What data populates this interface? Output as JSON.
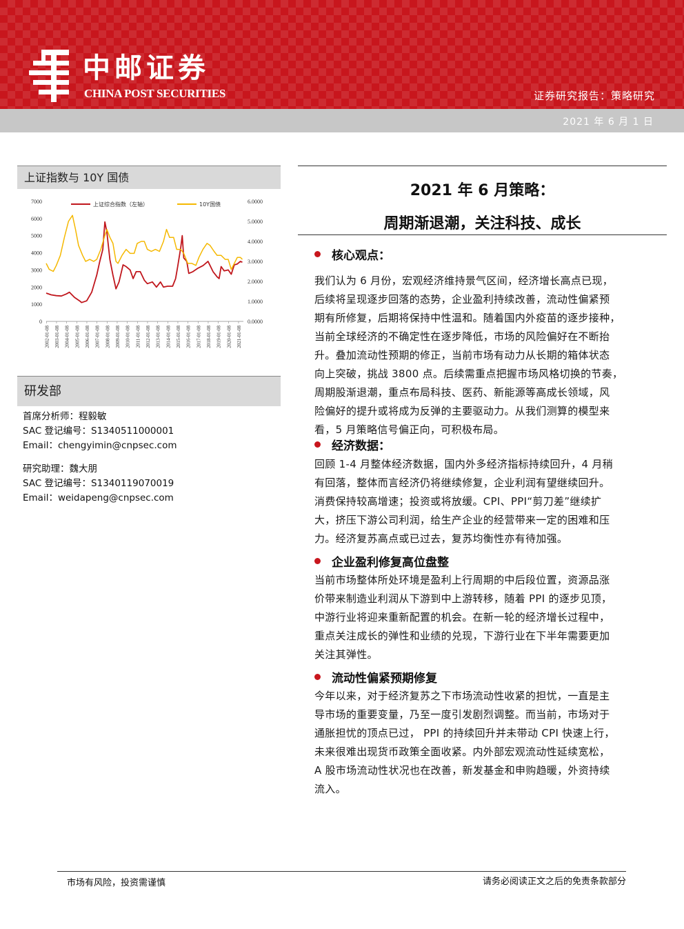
{
  "header": {
    "brand_cn": "中邮证券",
    "brand_en": "CHINA POST SECURITIES",
    "report_type": "证券研究报告：策略研究",
    "date": "2021 年 6 月 1 日",
    "colors": {
      "brand_red": "#c8161d",
      "date_bar": "#c7c7c7"
    }
  },
  "chart_box": {
    "title": "上证指数与 10Y 国债"
  },
  "chart_data": {
    "type": "line",
    "title": "",
    "xlabel": "",
    "ylabel": "",
    "x_ticks": [
      "2002-01-08",
      "2003-01-08",
      "2004-01-08",
      "2005-01-08",
      "2006-01-08",
      "2007-01-08",
      "2008-01-08",
      "2009-01-08",
      "2010-01-08",
      "2011-01-08",
      "2012-01-08",
      "2013-01-08",
      "2014-01-08",
      "2015-01-08",
      "2016-01-08",
      "2017-01-08",
      "2018-01-08",
      "2019-01-08",
      "2020-01-08",
      "2021-01-08"
    ],
    "ylim_left": [
      0,
      7000
    ],
    "yticks_left": [
      "7000",
      "6000",
      "5000",
      "4000",
      "3000",
      "2000",
      "1000",
      "0"
    ],
    "ylim_right": [
      0,
      6
    ],
    "yticks_right": [
      "6.0000",
      "5.0000",
      "4.0000",
      "3.0000",
      "2.0000",
      "1.0000",
      "0.0000"
    ],
    "legend_position": "top",
    "series": [
      {
        "name": "上证综合指数（左轴）",
        "axis": "left",
        "color": "#c0161c",
        "x": [
          2002.0,
          2002.5,
          2003.0,
          2003.5,
          2004.0,
          2004.3,
          2004.8,
          2005.3,
          2005.5,
          2006.0,
          2006.5,
          2007.0,
          2007.3,
          2007.6,
          2007.8,
          2008.0,
          2008.3,
          2008.6,
          2008.9,
          2009.2,
          2009.6,
          2009.9,
          2010.3,
          2010.6,
          2010.9,
          2011.3,
          2011.7,
          2012.0,
          2012.5,
          2012.9,
          2013.3,
          2013.6,
          2014.0,
          2014.5,
          2014.8,
          2015.0,
          2015.3,
          2015.45,
          2015.6,
          2015.9,
          2016.1,
          2016.5,
          2017.0,
          2017.5,
          2018.0,
          2018.5,
          2018.9,
          2019.1,
          2019.3,
          2019.6,
          2020.0,
          2020.3,
          2020.6,
          2020.9,
          2021.2,
          2021.4
        ],
        "y": [
          1650,
          1550,
          1500,
          1480,
          1600,
          1700,
          1400,
          1200,
          1100,
          1200,
          1700,
          2700,
          3500,
          4200,
          5800,
          5200,
          3600,
          2700,
          1900,
          2300,
          3300,
          3200,
          3000,
          2500,
          2900,
          2900,
          2400,
          2200,
          2300,
          2000,
          2300,
          2000,
          2050,
          2050,
          2500,
          3200,
          4300,
          5000,
          3700,
          3500,
          2800,
          2900,
          3100,
          3250,
          3500,
          2900,
          2600,
          2500,
          3200,
          2950,
          3000,
          2750,
          3300,
          3350,
          3500,
          3450
        ]
      },
      {
        "name": "10Y国债",
        "axis": "right",
        "color": "#f5b800",
        "x": [
          2002.0,
          2002.3,
          2002.7,
          2003.0,
          2003.4,
          2003.8,
          2004.2,
          2004.6,
          2004.9,
          2005.2,
          2005.6,
          2005.9,
          2006.3,
          2006.7,
          2007.0,
          2007.4,
          2007.8,
          2008.0,
          2008.3,
          2008.6,
          2008.9,
          2009.1,
          2009.5,
          2009.9,
          2010.3,
          2010.7,
          2011.0,
          2011.4,
          2011.7,
          2012.0,
          2012.4,
          2012.8,
          2013.2,
          2013.6,
          2013.9,
          2014.2,
          2014.6,
          2014.9,
          2015.3,
          2015.6,
          2016.0,
          2016.4,
          2016.8,
          2017.1,
          2017.5,
          2017.9,
          2018.2,
          2018.6,
          2018.9,
          2019.3,
          2019.7,
          2020.0,
          2020.3,
          2020.6,
          2020.9,
          2021.2,
          2021.4
        ],
        "y": [
          2.9,
          2.6,
          2.5,
          2.8,
          3.3,
          4.2,
          5.0,
          5.3,
          4.6,
          3.8,
          3.3,
          3.0,
          3.1,
          3.0,
          3.1,
          3.6,
          4.3,
          4.6,
          4.2,
          3.9,
          3.0,
          2.9,
          3.3,
          3.6,
          3.4,
          3.4,
          3.9,
          4.0,
          4.0,
          3.6,
          3.5,
          3.6,
          3.5,
          4.0,
          4.6,
          4.2,
          4.2,
          3.6,
          3.6,
          3.4,
          2.9,
          2.9,
          2.8,
          3.2,
          3.6,
          3.9,
          3.8,
          3.5,
          3.3,
          3.3,
          3.1,
          3.1,
          2.6,
          2.9,
          3.2,
          3.2,
          3.1
        ]
      }
    ]
  },
  "department": {
    "title": "研发部",
    "analyst1": {
      "role": "首席分析师：程毅敏",
      "sac": "SAC 登记编号：S1340511000001",
      "email": "Email：chengyimin@cnpsec.com"
    },
    "analyst2": {
      "role": "研究助理：魏大朋",
      "sac": "SAC 登记编号：S1340119070019",
      "email": "Email：weidapeng@cnpsec.com"
    }
  },
  "report": {
    "title_line1": "2021 年 6 月策略：",
    "title_line2": "周期渐退潮，关注科技、成长",
    "sections": [
      {
        "heading": "核心观点：",
        "lines": [
          "我们认为 6 月份，宏观经济维持景气区间，经济增长高点已现，",
          "后续将呈现逐步回落的态势，企业盈利持续改善，流动性偏紧预",
          "期有所修复，后期将保持中性温和。随着国内外疫苗的逐步接种，",
          "当前全球经济的不确定性在逐步降低，市场的风险偏好在不断抬",
          "升。叠加流动性预期的修正，当前市场有动力从长期的箱体状态",
          "向上突破，挑战 3800 点。后续需重点把握市场风格切换的节奏，",
          "周期股渐退潮，重点布局科技、医药、新能源等高成长领域，风",
          "险偏好的提升或将成为反弹的主要驱动力。从我们测算的模型来",
          "看，5 月策略信号偏正向，可积极布局。"
        ]
      },
      {
        "heading": "经济数据：",
        "lines": [
          "回顾 1-4 月整体经济数据，国内外多经济指标持续回升，4 月稍",
          "有回落，整体而言经济仍将继续修复，企业利润有望继续回升。",
          "消费保持较高增速；投资或将放缓。CPI、PPI“剪刀差”继续扩",
          "大，挤压下游公司利润，给生产企业的经营带来一定的困难和压",
          "力。经济复苏高点或已过去，复苏均衡性亦有待加强。"
        ]
      },
      {
        "heading": "企业盈利修复高位盘整",
        "lines": [
          "当前市场整体所处环境是盈利上行周期的中后段位置，资源品涨",
          "价带来制造业利润从下游到中上游转移，随着 PPI 的逐步见顶，",
          "中游行业将迎来重新配置的机会。在新一轮的经济增长过程中，",
          "重点关注成长的弹性和业绩的兑现，下游行业在下半年需要更加",
          "关注其弹性。"
        ]
      },
      {
        "heading": "流动性偏紧预期修复",
        "lines": [
          "今年以来，对于经济复苏之下市场流动性收紧的担忧，一直是主",
          "导市场的重要变量，乃至一度引发剧烈调整。而当前，市场对于",
          "通胀担忧的顶点已过， PPI 的持续回升并未带动 CPI 快速上行，",
          "未来很难出现货币政策全面收紧。内外部宏观流动性延续宽松，",
          "A 股市场流动性状况也在改善，新发基金和申购趋暖，外资持续",
          "流入。"
        ]
      }
    ]
  },
  "footer": {
    "left": "市场有风险，投资需谨慎",
    "right": "请务必阅读正文之后的免责条款部分"
  }
}
